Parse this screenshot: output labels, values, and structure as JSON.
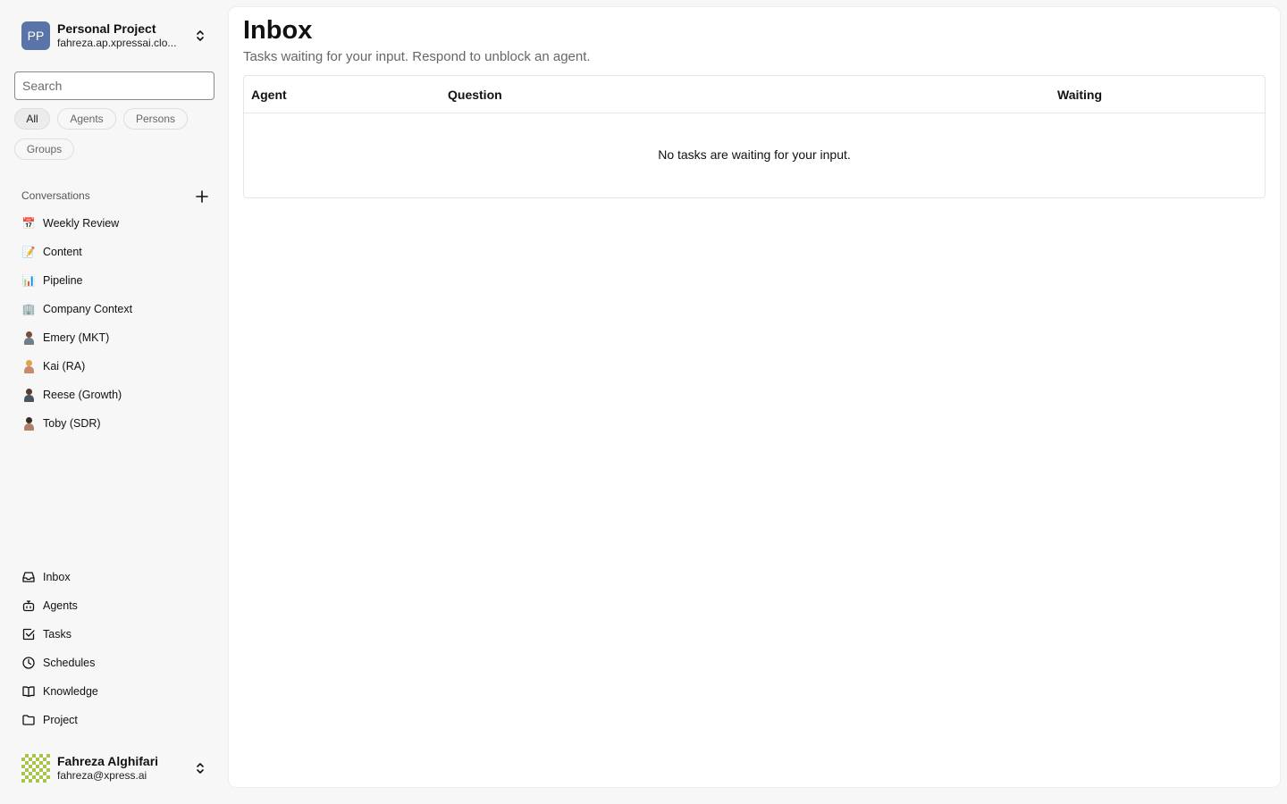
{
  "project": {
    "initials": "PP",
    "name": "Personal Project",
    "subtitle": "fahreza.ap.xpressai.clo...",
    "avatar_color": "#5b74a8"
  },
  "search": {
    "placeholder": "Search",
    "value": ""
  },
  "filters": [
    {
      "label": "All",
      "active": true
    },
    {
      "label": "Agents",
      "active": false
    },
    {
      "label": "Persons",
      "active": false
    },
    {
      "label": "Groups",
      "active": false
    }
  ],
  "conversations": {
    "title": "Conversations",
    "add_icon": "plus-icon",
    "items": [
      {
        "label": "Weekly Review",
        "icon": "calendar-emoji-icon",
        "glyph": "📅"
      },
      {
        "label": "Content",
        "icon": "memo-emoji-icon",
        "glyph": "📝"
      },
      {
        "label": "Pipeline",
        "icon": "bar-chart-emoji-icon",
        "glyph": "📊"
      },
      {
        "label": "Company Context",
        "icon": "office-building-emoji-icon",
        "glyph": "🏢"
      },
      {
        "label": "Emery (MKT)",
        "icon": "person-avatar-icon"
      },
      {
        "label": "Kai (RA)",
        "icon": "person-avatar-icon"
      },
      {
        "label": "Reese (Growth)",
        "icon": "person-avatar-icon"
      },
      {
        "label": "Toby (SDR)",
        "icon": "person-avatar-icon"
      }
    ]
  },
  "nav": [
    {
      "label": "Inbox",
      "icon": "inbox-icon"
    },
    {
      "label": "Agents",
      "icon": "bot-icon"
    },
    {
      "label": "Tasks",
      "icon": "checkbox-icon"
    },
    {
      "label": "Schedules",
      "icon": "clock-icon"
    },
    {
      "label": "Knowledge",
      "icon": "book-icon"
    },
    {
      "label": "Project",
      "icon": "folder-icon"
    }
  ],
  "user": {
    "name": "Fahreza Alghifari",
    "email": "fahreza@xpress.ai",
    "avatar_color": "#a6c64a"
  },
  "main": {
    "title": "Inbox",
    "subtitle": "Tasks waiting for your input. Respond to unblock an agent.",
    "columns": [
      "Agent",
      "Question",
      "Waiting"
    ],
    "empty_message": "No tasks are waiting for your input."
  }
}
